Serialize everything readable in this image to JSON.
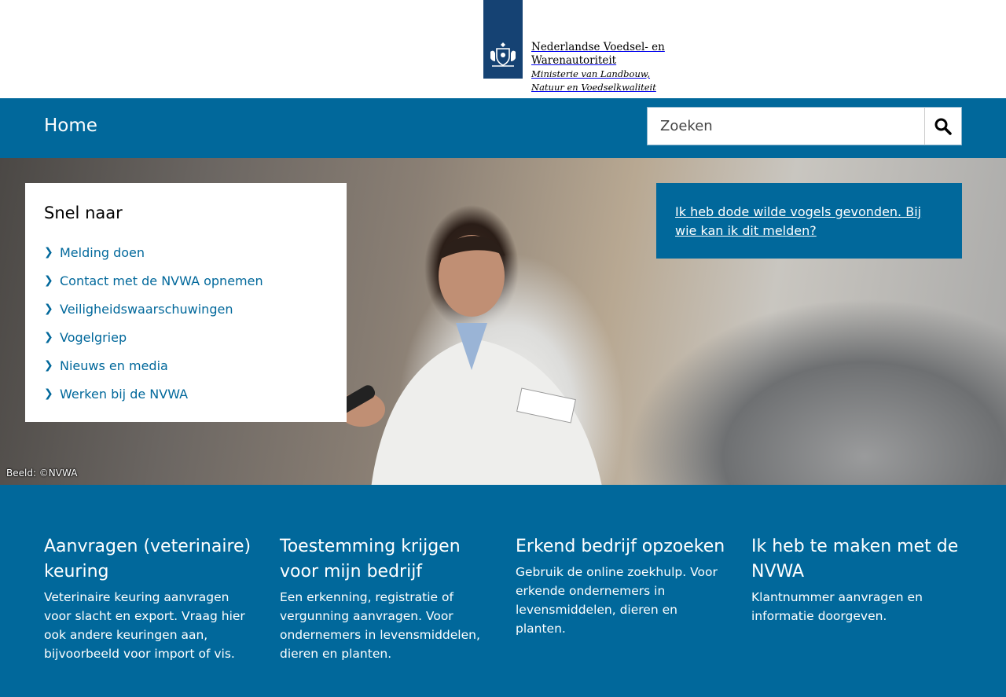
{
  "header": {
    "logo": {
      "line1": "Nederlandse Voedsel- en",
      "line2": "Warenautoriteit",
      "line3": "Ministerie van Landbouw,",
      "line4": "Natuur en Voedselkwaliteit"
    }
  },
  "nav": {
    "home_label": "Home",
    "search_placeholder": "Zoeken",
    "search_button_icon": "search-icon"
  },
  "hero": {
    "credit": "Beeld: ©NVWA",
    "quick_links": {
      "title": "Snel naar",
      "items": [
        {
          "label": "Melding doen"
        },
        {
          "label": "Contact met de NVWA opnemen"
        },
        {
          "label": "Veiligheidswaarschuwingen"
        },
        {
          "label": "Vogelgriep"
        },
        {
          "label": "Nieuws en media"
        },
        {
          "label": "Werken bij de NVWA"
        }
      ]
    },
    "alert_link": "Ik heb dode wilde vogels gevonden. Bij wie kan ik dit melden?"
  },
  "cards": [
    {
      "title": "Aanvragen (veterinaire) keuring",
      "text": "Veterinaire keuring aanvragen voor slacht en export. Vraag hier ook andere keuringen aan, bijvoorbeeld voor import of vis."
    },
    {
      "title": "Toestemming krijgen voor mijn bedrijf",
      "text": "Een erkenning, registratie of vergunning aanvragen. Voor ondernemers in levensmiddelen, dieren en planten."
    },
    {
      "title": "Erkend bedrijf opzoeken",
      "text": "Gebruik de online zoekhulp. Voor erkende ondernemers in levensmiddelen, dieren en planten."
    },
    {
      "title": "Ik heb te maken met de NVWA",
      "text": "Klantnummer aanvragen en informatie doorgeven."
    }
  ],
  "colors": {
    "brand_blue": "#01689b",
    "logo_blue": "#154273"
  }
}
